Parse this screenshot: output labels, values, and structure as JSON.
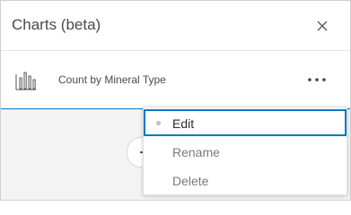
{
  "panel": {
    "title": "Charts (beta)",
    "close_icon": "close-icon"
  },
  "chart": {
    "label": "Count by Mineral Type",
    "icon": "bar-chart-icon",
    "more_icon": "ellipsis-icon"
  },
  "menu": {
    "items": [
      {
        "label": "Edit",
        "selected": true
      },
      {
        "label": "Rename",
        "selected": false
      },
      {
        "label": "Delete",
        "selected": false
      }
    ]
  },
  "colors": {
    "accent": "#0079c1",
    "text": "#4a4a4a",
    "muted": "#7a7a7a"
  }
}
